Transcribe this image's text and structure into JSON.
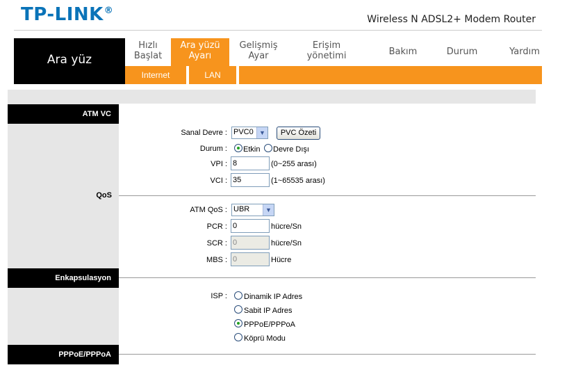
{
  "header": {
    "logo": "TP-LINK",
    "logo_reg": "®",
    "product": "Wireless N ADSL2+ Modem Router"
  },
  "nav": {
    "section_title": "Ara yüz",
    "items": [
      {
        "line1": "Hızlı",
        "line2": "Başlat"
      },
      {
        "line1": "Ara yüzü",
        "line2": "Ayarı"
      },
      {
        "line1": "Gelişmiş",
        "line2": "Ayar"
      },
      {
        "line1": "Erişim",
        "line2": "yönetimi"
      },
      {
        "line1": "Bakım",
        "line2": ""
      },
      {
        "line1": "Durum",
        "line2": ""
      },
      {
        "line1": "Yardım",
        "line2": ""
      }
    ],
    "subtabs": [
      "Internet",
      "LAN"
    ]
  },
  "sections": {
    "atm_vc": "ATM VC",
    "qos": "QoS",
    "encapsulation": "Enkapsulasyon",
    "pppoe": "PPPoE/PPPoA"
  },
  "form": {
    "virtual_circuit_label": "Sanal Devre :",
    "virtual_circuit_value": "PVC0",
    "pvc_summary_button": "PVC Özeti",
    "status_label": "Durum :",
    "status_enabled": "Etkin",
    "status_disabled": "Devre Dışı",
    "vpi_label": "VPI :",
    "vpi_value": "8",
    "vpi_range": "(0~255 arası)",
    "vci_label": "VCI :",
    "vci_value": "35",
    "vci_range": "(1~65535 arası)",
    "atm_qos_label": "ATM QoS :",
    "atm_qos_value": "UBR",
    "pcr_label": "PCR :",
    "pcr_value": "0",
    "pcr_unit": "hücre/Sn",
    "scr_label": "SCR :",
    "scr_value": "0",
    "scr_unit": "hücre/Sn",
    "mbs_label": "MBS :",
    "mbs_value": "0",
    "mbs_unit": "Hücre",
    "isp_label": "ISP :",
    "isp_options": [
      "Dinamik IP Adres",
      "Sabit IP Adres",
      "PPPoE/PPPoA",
      "Köprü Modu"
    ],
    "isp_selected": "PPPoE/PPPoA"
  },
  "colors": {
    "accent": "#f7941d",
    "logo": "#0a73b8",
    "panel": "#e6e6e6"
  }
}
